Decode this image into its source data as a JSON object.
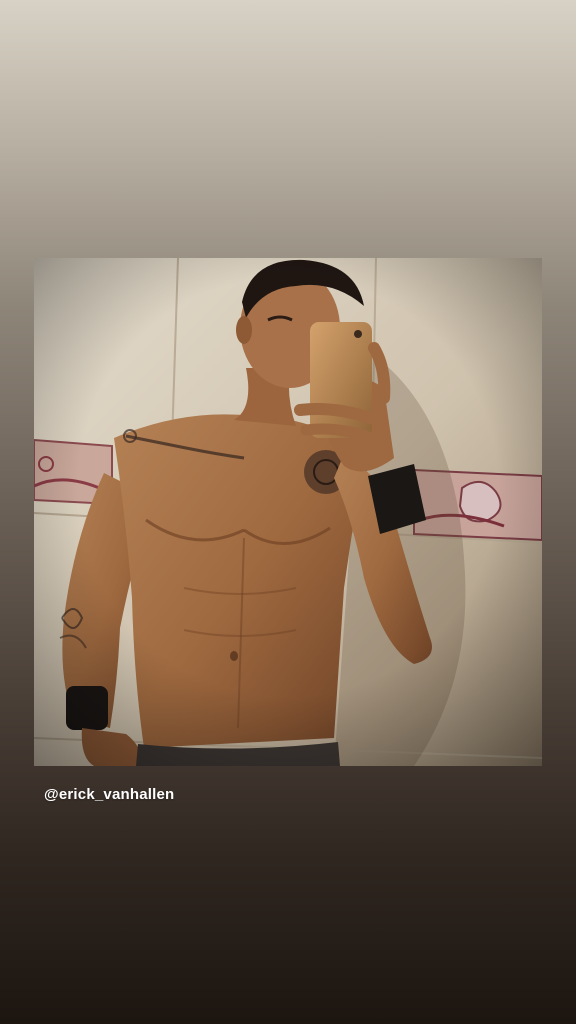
{
  "story": {
    "mention_text": "@erick_vanhallen",
    "photo_alt": "Mirror selfie photo"
  },
  "colors": {
    "background_top": "#d8d2c6",
    "background_bottom": "#1c1510",
    "mention_text": "#ffffff"
  }
}
